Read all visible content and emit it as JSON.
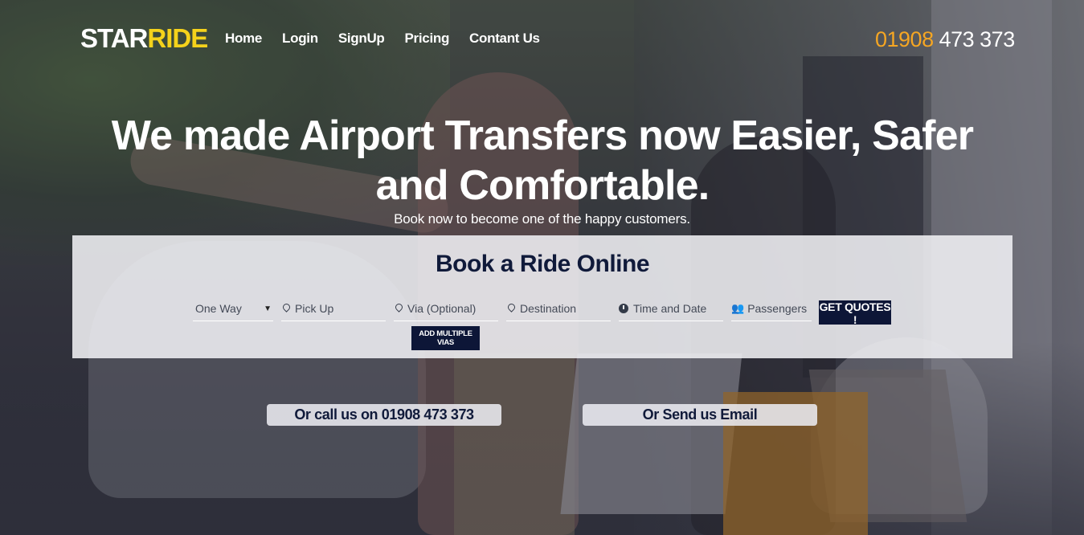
{
  "header": {
    "logo_part1": "STAR",
    "logo_part2": "RIDE",
    "nav": [
      "Home",
      "Login",
      "SignUp",
      "Pricing",
      "Contant Us"
    ],
    "phone_code": "01908",
    "phone_number": "473 373"
  },
  "hero": {
    "title": "We made Airport Transfers now Easier, Safer and Comfortable.",
    "subtitle": "Book now to become one of the happy customers."
  },
  "booking": {
    "title": "Book a Ride Online",
    "trip_type": "One Way",
    "pickup_placeholder": "Pick Up",
    "via_placeholder": "Via (Optional)",
    "destination_placeholder": "Destination",
    "time_placeholder": "Time and Date",
    "passengers_placeholder": "Passengers",
    "get_quotes_label": "GET QUOTES !",
    "add_vias_label": "ADD MULTIPLE VIAS"
  },
  "cta": {
    "call_label": "Or call us on 01908 473 373",
    "email_label": "Or Send us Email"
  },
  "colors": {
    "brand_yellow": "#f5d21b",
    "phone_orange": "#f5a623",
    "navy": "#0d1637"
  },
  "icons": [
    "caret-down-icon",
    "map-pin-icon",
    "clock-icon",
    "users-icon"
  ]
}
